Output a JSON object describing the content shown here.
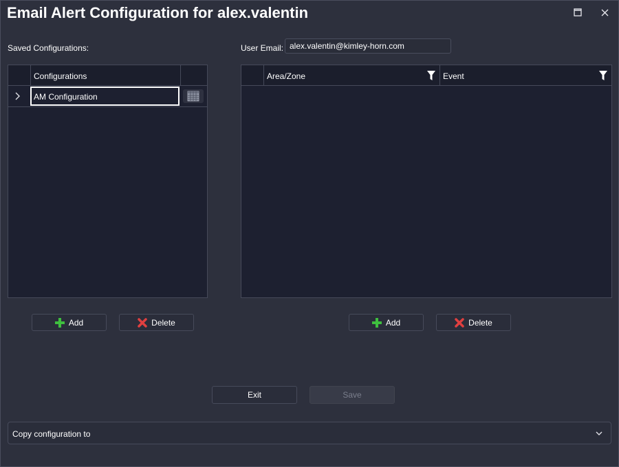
{
  "window": {
    "title": "Email Alert Configuration for alex.valentin"
  },
  "left": {
    "section_label": "Saved Configurations:",
    "grid": {
      "column_header": "Configurations",
      "rows": [
        {
          "name": "AM Configuration"
        }
      ]
    },
    "add_label": "Add",
    "delete_label": "Delete"
  },
  "right": {
    "email_label": "User Email:",
    "email_value": "alex.valentin@kimley-horn.com",
    "grid": {
      "columns": [
        "Area/Zone",
        "Event"
      ]
    },
    "add_label": "Add",
    "delete_label": "Delete"
  },
  "footer": {
    "exit_label": "Exit",
    "save_label": "Save",
    "copy_label": "Copy configuration to"
  },
  "icons": {
    "add": "plus-icon",
    "delete": "x-icon",
    "filter": "filter-icon",
    "expand": "chevron-right-icon",
    "dropdown": "chevron-down-icon",
    "grid_cell": "table-icon",
    "maximize": "maximize-icon",
    "close": "close-icon"
  },
  "colors": {
    "accent_add": "#3fbf3f",
    "accent_delete": "#e04040"
  }
}
